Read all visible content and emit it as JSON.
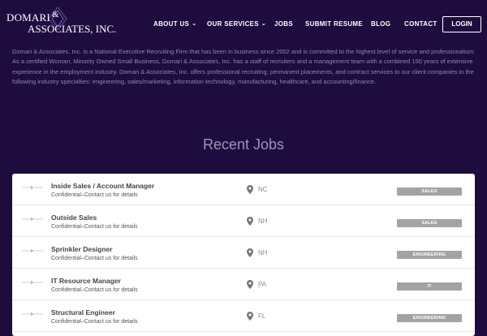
{
  "brand": {
    "line1": "DOMARI",
    "amp": "&",
    "line2": "ASSOCIATES, INC."
  },
  "nav": {
    "items": [
      {
        "label": "ABOUT US",
        "has_dropdown": true
      },
      {
        "label": "OUR SERVICES",
        "has_dropdown": true
      },
      {
        "label": "JOBS",
        "has_dropdown": false
      },
      {
        "label": "SUBMIT RESUME",
        "has_dropdown": false
      },
      {
        "label": "BLOG",
        "has_dropdown": false
      },
      {
        "label": "CONTACT",
        "has_dropdown": false
      }
    ],
    "login_label": "LOGIN",
    "chevron": "⌄"
  },
  "intro": {
    "text": "Domari & Associates, Inc. is a National Executive Recruiting Firm that has been in business since 2002 and is committed to the highest level of service and professionalism. As a certified Woman, Minority Owned Small Business, Domari & Associates, Inc. has a staff of recruiters and a management team with a combined 150 years of extensive experience in the employment industry. Domari & Associates, Inc. offers professional recruiting, permanent placements, and contract services to our client companies in the following industry specialties: engineering, sales/marketing, information technology, manufacturing, healthcare, and accounting/finance."
  },
  "recent_jobs": {
    "title": "Recent Jobs",
    "jobs": [
      {
        "title": "Inside Sales / Account Manager",
        "subtitle": "Confidential–Contact us for details",
        "location": "NC",
        "category": "SALES"
      },
      {
        "title": "Outside Sales",
        "subtitle": "Confidential–Contact us for details",
        "location": "NH",
        "category": "SALES"
      },
      {
        "title": "Sprinkler Designer",
        "subtitle": "Confidential–Contact us for details",
        "location": "NH",
        "category": "ENGINEERING"
      },
      {
        "title": "IT Resource Manager",
        "subtitle": "Confidential–Contact us for details",
        "location": "PA",
        "category": "IT"
      },
      {
        "title": "Structural Engineer",
        "subtitle": "Confidential–Contact us for details",
        "location": "FL",
        "category": "ENGINEERING"
      }
    ]
  },
  "colors": {
    "background": "#1e0c3f",
    "intro_text": "#8e84b4",
    "badge": "#a3a3a3",
    "card": "#ffffff"
  },
  "icons": [
    "domari-logo-mark",
    "chevron-down-icon",
    "location-pin-icon",
    "company-logo-icon"
  ]
}
